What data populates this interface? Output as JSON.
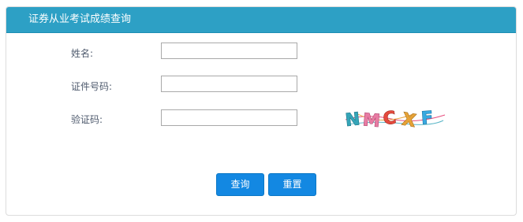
{
  "panel": {
    "title": "证券从业考试成绩查询"
  },
  "form": {
    "name_label": "姓名:",
    "name_value": "",
    "id_label": "证件号码:",
    "id_value": "",
    "captcha_label": "验证码:",
    "captcha_value": ""
  },
  "captcha": {
    "text": "NMCXF",
    "icon": "captcha-image"
  },
  "buttons": {
    "query_label": "查询",
    "reset_label": "重置"
  },
  "colors": {
    "header": "#2da0c5",
    "button": "#1388e2",
    "label": "#4e5a6d"
  }
}
